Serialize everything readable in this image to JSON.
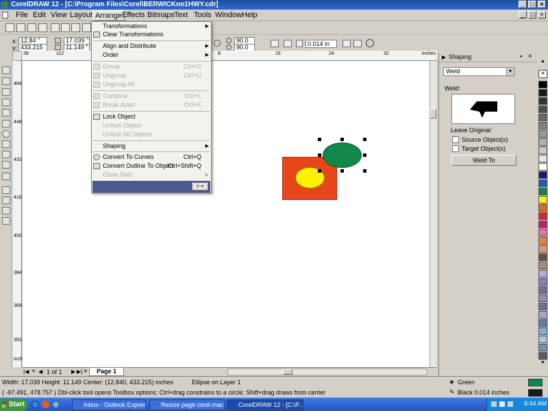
{
  "title": "CorelDRAW 12 - [C:\\Program Files\\Corel\\BERWICKno1HWY.cdr]",
  "window_buttons": [
    "_",
    "□",
    "×"
  ],
  "inner_window_buttons": [
    "_",
    "□",
    "×"
  ],
  "menu": [
    {
      "label": "File"
    },
    {
      "label": "Edit"
    },
    {
      "label": "View"
    },
    {
      "label": "Layout"
    },
    {
      "label": "Arrange"
    },
    {
      "label": "Effects"
    },
    {
      "label": "Bitmaps"
    },
    {
      "label": "Text"
    },
    {
      "label": "Tools"
    },
    {
      "label": "Window"
    },
    {
      "label": "Help"
    }
  ],
  "property_bar": {
    "x_label": "x:",
    "y_label": "y:",
    "x_value": "12.84 \"",
    "y_value": "433.215 \"",
    "w_value": "17.039 \"",
    "h_value": "11.149 \"",
    "angle1": "90.0",
    "angle2": "90.0",
    "outline": "0.014 in"
  },
  "arrange_menu": {
    "items": [
      {
        "label": "Transformations",
        "shortcut": "",
        "submenu": true,
        "disabled": false
      },
      {
        "label": "Clear Transformations",
        "shortcut": "",
        "submenu": false,
        "disabled": false
      },
      {
        "label": "Align and Distribute",
        "shortcut": "",
        "submenu": true,
        "disabled": false
      },
      {
        "label": "Order",
        "shortcut": "",
        "submenu": true,
        "disabled": false
      },
      {
        "label": "Group",
        "shortcut": "Ctrl+G",
        "submenu": false,
        "disabled": true
      },
      {
        "label": "Ungroup",
        "shortcut": "Ctrl+U",
        "submenu": false,
        "disabled": true
      },
      {
        "label": "Ungroup All",
        "shortcut": "",
        "submenu": false,
        "disabled": true
      },
      {
        "label": "Combine",
        "shortcut": "Ctrl+L",
        "submenu": false,
        "disabled": true
      },
      {
        "label": "Break Apart",
        "shortcut": "Ctrl+K",
        "submenu": false,
        "disabled": true
      },
      {
        "label": "Lock Object",
        "shortcut": "",
        "submenu": false,
        "disabled": false
      },
      {
        "label": "Unlock Object",
        "shortcut": "",
        "submenu": false,
        "disabled": true
      },
      {
        "label": "Unlock All Objects",
        "shortcut": "",
        "submenu": false,
        "disabled": true
      },
      {
        "label": "Shaping",
        "shortcut": "",
        "submenu": true,
        "disabled": false
      },
      {
        "label": "Convert To Curves",
        "shortcut": "Ctrl+Q",
        "submenu": false,
        "disabled": false
      },
      {
        "label": "Convert Outline To Object",
        "shortcut": "Ctrl+Shift+Q",
        "submenu": false,
        "disabled": false
      },
      {
        "label": "Close Path",
        "shortcut": "",
        "submenu": true,
        "disabled": true
      }
    ]
  },
  "ruler": {
    "h_labels": [
      "28",
      "112",
      "8",
      "16",
      "24",
      "32"
    ],
    "units": "inches",
    "v_labels": [
      "464",
      "448",
      "432",
      "416",
      "400",
      "384",
      "368",
      "352"
    ]
  },
  "page_nav": {
    "page_count": "1 of 1",
    "page_tab": "Page 1"
  },
  "docker": {
    "title": "Shaping",
    "mode": "Weld",
    "section_label": "Weld:",
    "leave_original": "Leave Original:",
    "source_label": "Source Object(s)",
    "target_label": "Target Object(s)",
    "button": "Weld To"
  },
  "palette_colors": [
    "#000000",
    "#1a1a1a",
    "#333333",
    "#4d4d4d",
    "#666666",
    "#808080",
    "#999999",
    "#b3b3b3",
    "#cccccc",
    "#e6e6e6",
    "#ffffff",
    "#1c1c7a",
    "#1060c0",
    "#10884a",
    "#fff200",
    "#e6661a",
    "#e0202a",
    "#d01870",
    "#f070a0",
    "#f08030",
    "#f08c78",
    "#6a5040",
    "#a09080",
    "#b0b0e0",
    "#8080c0",
    "#7070a0",
    "#9090b0",
    "#707090",
    "#9aaad0",
    "#6a7aa0",
    "#7ab0d8",
    "#a8c8e0",
    "#7890a8",
    "#506070"
  ],
  "status": {
    "line1": "Width: 17.039  Height: 11.149  Center: (12.840, 433.215)  inches",
    "layer": "Ellipse on Layer 1",
    "line2": "( -97.491, 478.757 )   Dbl-click tool opens Toolbox options; Ctrl+drag constrains to a circle; Shift+drag draws from center",
    "fill_name": "Green",
    "fill_color": "#0a8a4a",
    "outline_name": "Black  0.014 inches",
    "outline_color": "#1a1a1a"
  },
  "taskbar": {
    "start": "Start",
    "tasks": [
      {
        "label": "Inbox - Outlook Express"
      },
      {
        "label": "Resize page corel macro ..."
      },
      {
        "label": "CorelDRAW 12 - [C:\\P..."
      }
    ],
    "time": "8:44 AM"
  }
}
